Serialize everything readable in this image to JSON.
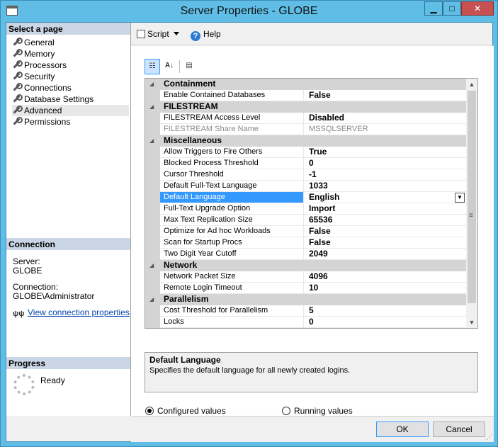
{
  "window": {
    "title": "Server Properties - GLOBE",
    "minimize": "▁",
    "maximize": "□",
    "close": "✕"
  },
  "left": {
    "select_page_header": "Select a page",
    "pages": [
      "General",
      "Memory",
      "Processors",
      "Security",
      "Connections",
      "Database Settings",
      "Advanced",
      "Permissions"
    ],
    "selected_page": "Advanced",
    "connection_header": "Connection",
    "server_label": "Server:",
    "server_value": "GLOBE",
    "connection_label": "Connection:",
    "connection_value": "GLOBE\\Administrator",
    "view_link": "View connection properties",
    "progress_header": "Progress",
    "progress_status": "Ready"
  },
  "toolbar": {
    "script_label": "Script",
    "help_label": "Help"
  },
  "property_toolbar": {
    "categorized_icon": "categorized-icon",
    "alphabetical_icon": "alphabetical-icon",
    "pages_icon": "property-pages-icon"
  },
  "grid": {
    "rows": [
      {
        "kind": "cat",
        "label": "Containment"
      },
      {
        "kind": "prop",
        "name": "Enable Contained Databases",
        "value": "False"
      },
      {
        "kind": "cat",
        "label": "FILESTREAM"
      },
      {
        "kind": "prop",
        "name": "FILESTREAM Access Level",
        "value": "Disabled"
      },
      {
        "kind": "prop",
        "name": "FILESTREAM Share Name",
        "value": "MSSQLSERVER",
        "readonly": true
      },
      {
        "kind": "cat",
        "label": "Miscellaneous"
      },
      {
        "kind": "prop",
        "name": "Allow Triggers to Fire Others",
        "value": "True"
      },
      {
        "kind": "prop",
        "name": "Blocked Process Threshold",
        "value": "0"
      },
      {
        "kind": "prop",
        "name": "Cursor Threshold",
        "value": "-1"
      },
      {
        "kind": "prop",
        "name": "Default Full-Text Language",
        "value": "1033"
      },
      {
        "kind": "prop",
        "name": "Default Language",
        "value": "English",
        "selected": true
      },
      {
        "kind": "prop",
        "name": "Full-Text Upgrade Option",
        "value": "Import"
      },
      {
        "kind": "prop",
        "name": "Max Text Replication Size",
        "value": "65536"
      },
      {
        "kind": "prop",
        "name": "Optimize for Ad hoc Workloads",
        "value": "False"
      },
      {
        "kind": "prop",
        "name": "Scan for Startup Procs",
        "value": "False"
      },
      {
        "kind": "prop",
        "name": "Two Digit Year Cutoff",
        "value": "2049"
      },
      {
        "kind": "cat",
        "label": "Network"
      },
      {
        "kind": "prop",
        "name": "Network Packet Size",
        "value": "4096"
      },
      {
        "kind": "prop",
        "name": "Remote Login Timeout",
        "value": "10"
      },
      {
        "kind": "cat",
        "label": "Parallelism"
      },
      {
        "kind": "prop",
        "name": "Cost Threshold for Parallelism",
        "value": "5"
      },
      {
        "kind": "prop",
        "name": "Locks",
        "value": "0"
      }
    ]
  },
  "description": {
    "title": "Default Language",
    "text": "Specifies the default language for all newly created logins."
  },
  "radios": {
    "configured": "Configured values",
    "running": "Running values",
    "selected": "configured"
  },
  "footer": {
    "ok": "OK",
    "cancel": "Cancel"
  }
}
